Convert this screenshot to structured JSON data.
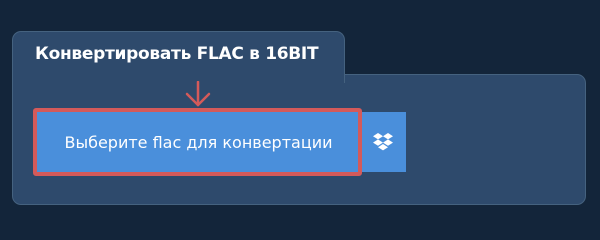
{
  "converter": {
    "title": "Конвертировать FLAC в 16BIT",
    "upload_label": "Выберите flac для конвертации",
    "dropbox_icon": "dropbox-icon",
    "pointer_icon": "arrow-down-icon"
  },
  "colors": {
    "background": "#13253a",
    "panel": "#2e4a6c",
    "button": "#4a8fdb",
    "highlight": "#d45a5a"
  }
}
